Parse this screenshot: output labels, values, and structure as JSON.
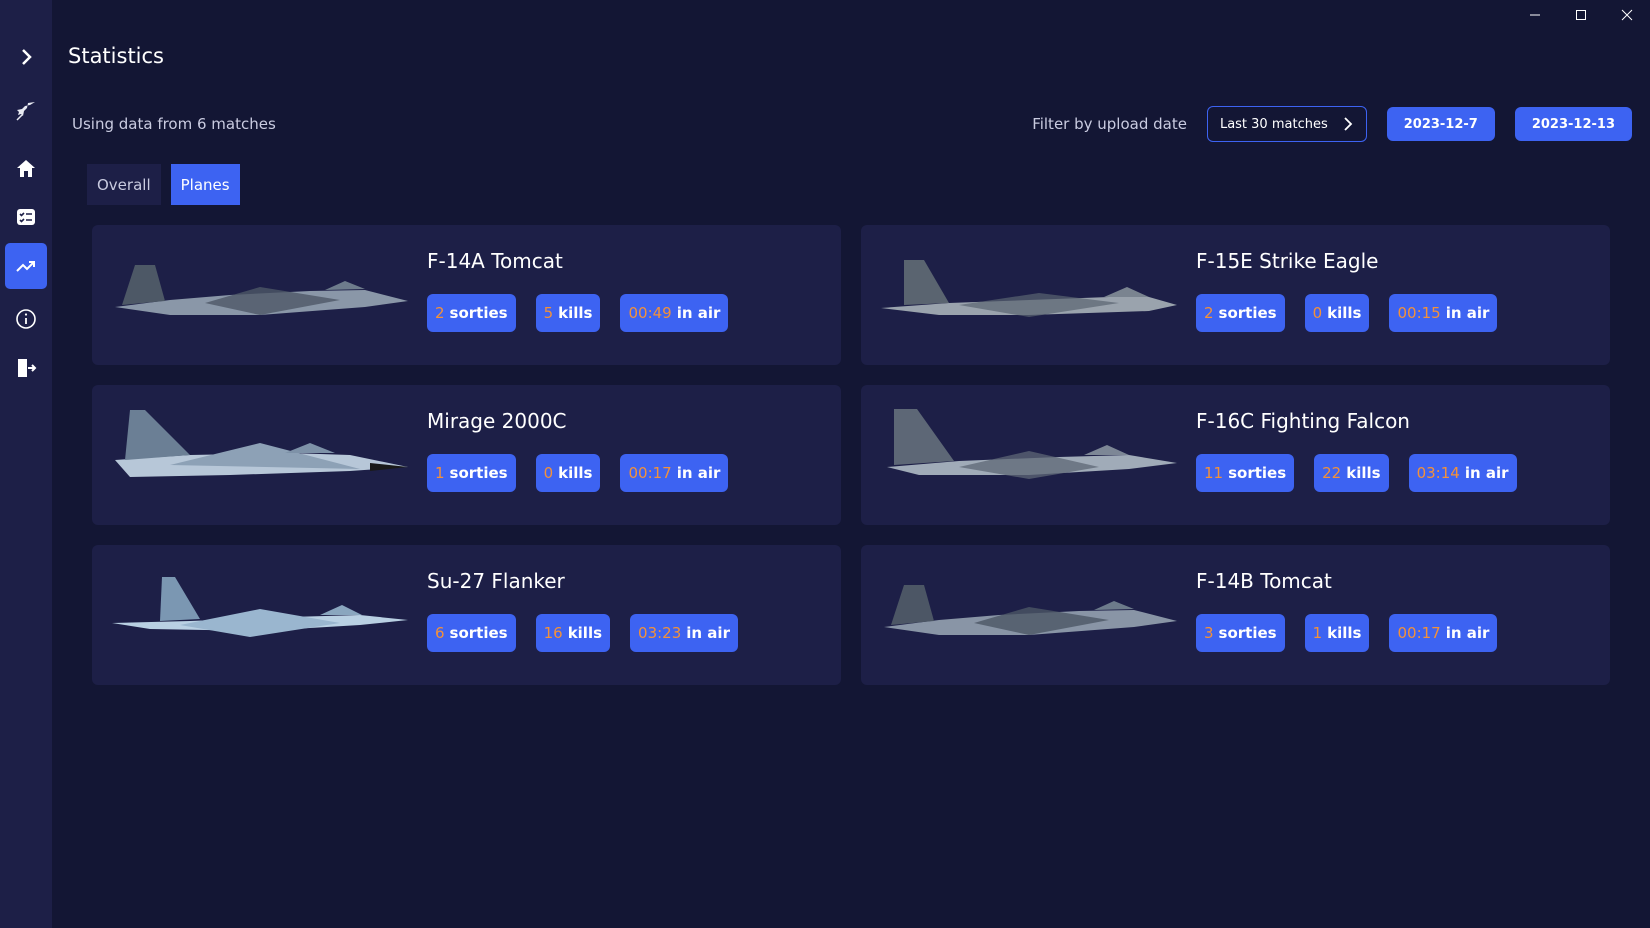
{
  "window": {
    "title": "Statistics",
    "controls": [
      "minimize-icon",
      "maximize-icon",
      "close-icon"
    ]
  },
  "sidebar": {
    "items": [
      {
        "name": "chevron-right-icon"
      },
      {
        "name": "jet-logo-icon"
      },
      {
        "name": "home-icon"
      },
      {
        "name": "checklist-icon"
      },
      {
        "name": "trending-up-icon",
        "active": true
      },
      {
        "name": "info-icon"
      },
      {
        "name": "logout-icon"
      }
    ]
  },
  "header": {
    "using_data": "Using data from 6 matches",
    "filter_label": "Filter by upload date",
    "filter_value": "Last 30 matches",
    "date_from": "2023-12-7",
    "date_to": "2023-12-13"
  },
  "tabs": [
    {
      "label": "Overall",
      "active": false
    },
    {
      "label": "Planes",
      "active": true
    }
  ],
  "labels": {
    "sorties": "sorties",
    "kills": "kills",
    "in_air": "in air"
  },
  "planes": [
    {
      "name": "F-14A Tomcat",
      "sorties": "2",
      "kills": "5",
      "time": "00:49",
      "colors": {
        "body": "#8a97a8",
        "dark": "#4d5866"
      }
    },
    {
      "name": "F-15E Strike Eagle",
      "sorties": "2",
      "kills": "0",
      "time": "00:15",
      "colors": {
        "body": "#9aa3ad",
        "dark": "#5a6470"
      }
    },
    {
      "name": "Mirage 2000C",
      "sorties": "1",
      "kills": "0",
      "time": "00:17",
      "colors": {
        "body": "#b7c7d8",
        "dark": "#6b7f95"
      }
    },
    {
      "name": "F-16C Fighting Falcon",
      "sorties": "11",
      "kills": "22",
      "time": "03:14",
      "colors": {
        "body": "#a0abb8",
        "dark": "#5d6776"
      }
    },
    {
      "name": "Su-27 Flanker",
      "sorties": "6",
      "kills": "16",
      "time": "03:23",
      "colors": {
        "body": "#b9d0e3",
        "dark": "#7b97b2"
      }
    },
    {
      "name": "F-14B Tomcat",
      "sorties": "3",
      "kills": "1",
      "time": "00:17",
      "colors": {
        "body": "#8995a6",
        "dark": "#4c5665"
      }
    }
  ],
  "colors": {
    "background": "#131634",
    "panel": "#1d1f47",
    "accent": "#3d63f2",
    "highlight": "#f3913a"
  }
}
